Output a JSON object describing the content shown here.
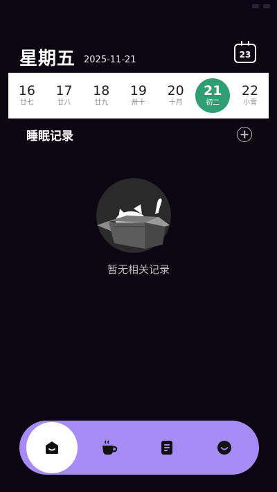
{
  "header": {
    "weekday": "星期五",
    "date": "2025-11-21",
    "calendar_icon_day": "23"
  },
  "week": [
    {
      "day": "16",
      "lunar": "廿七",
      "selected": false
    },
    {
      "day": "17",
      "lunar": "廿八",
      "selected": false
    },
    {
      "day": "18",
      "lunar": "廿九",
      "selected": false
    },
    {
      "day": "19",
      "lunar": "卅十",
      "selected": false
    },
    {
      "day": "20",
      "lunar": "十月",
      "selected": false
    },
    {
      "day": "21",
      "lunar": "初二",
      "selected": true
    },
    {
      "day": "22",
      "lunar": "小雪",
      "selected": false
    }
  ],
  "section": {
    "title": "睡眠记录"
  },
  "empty_state": {
    "text": "暂无相关记录"
  },
  "colors": {
    "background": "#0b0612",
    "selected_day": "#2f9e74",
    "nav_bar": "#a78bf5"
  },
  "bottom_nav": {
    "items": [
      {
        "icon": "home-icon",
        "active": true
      },
      {
        "icon": "coffee-cup-icon",
        "active": false
      },
      {
        "icon": "document-icon",
        "active": false
      },
      {
        "icon": "smile-icon",
        "active": false
      }
    ]
  }
}
